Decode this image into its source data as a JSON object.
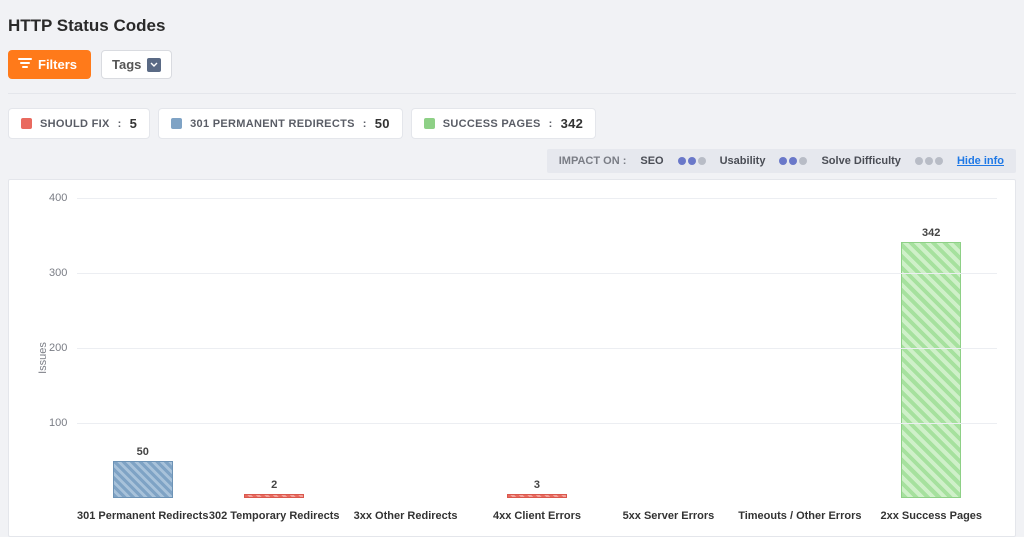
{
  "title": "HTTP Status Codes",
  "toolbar": {
    "filters_label": "Filters",
    "tags_label": "Tags"
  },
  "legend_pills": [
    {
      "label": "SHOULD FIX",
      "count": "5",
      "color": "#e96a5f"
    },
    {
      "label": "301 PERMANENT REDIRECTS",
      "count": "50",
      "color": "#7fa3c5"
    },
    {
      "label": "SUCCESS PAGES",
      "count": "342",
      "color": "#8ed086"
    }
  ],
  "impact_bar": {
    "lead": "IMPACT ON  :",
    "seo": "SEO",
    "usability": "Usability",
    "solve": "Solve Difficulty",
    "hide": "Hide info"
  },
  "chart_data": {
    "type": "bar",
    "ylabel": "Issues",
    "ylim": [
      0,
      400
    ],
    "yticks": [
      100,
      200,
      300,
      400
    ],
    "categories": [
      "301 Permanent Redirects",
      "302 Temporary Redirects",
      "3xx Other Redirects",
      "4xx Client Errors",
      "5xx Server Errors",
      "Timeouts / Other Errors",
      "2xx Success Pages"
    ],
    "values": [
      50,
      2,
      0,
      3,
      0,
      0,
      342
    ],
    "bar_style": [
      "blue",
      "red",
      "red",
      "red",
      "red",
      "red",
      "green"
    ],
    "show_label": [
      true,
      true,
      false,
      true,
      false,
      false,
      true
    ]
  }
}
